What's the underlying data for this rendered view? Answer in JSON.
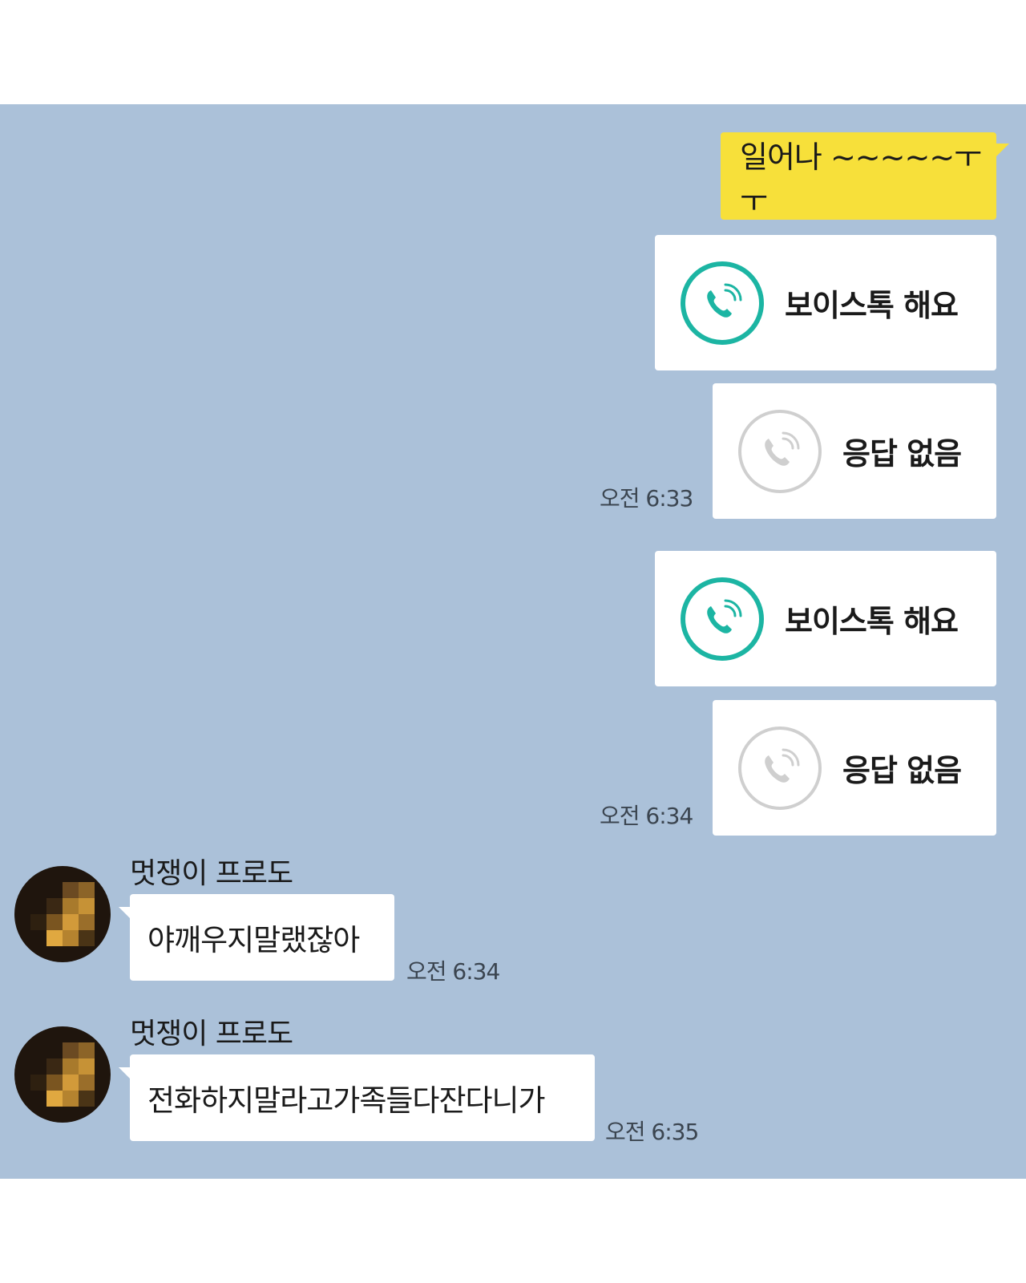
{
  "messages": [
    {
      "type": "text",
      "text": "일어나 ~~~~~ㅜㅜ"
    },
    {
      "type": "call",
      "label": "보이스톡 해요"
    },
    {
      "type": "call",
      "label": "응답 없음",
      "time": "오전 6:33"
    },
    {
      "type": "call",
      "label": "보이스톡 해요"
    },
    {
      "type": "call",
      "label": "응답 없음",
      "time": "오전 6:34"
    },
    {
      "type": "text",
      "sender": "멋쟁이 프로도",
      "text": "야깨우지말랬잖아",
      "time": "오전 6:34"
    },
    {
      "type": "text",
      "sender": "멋쟁이 프로도",
      "text": "전화하지말라고가족들다잔다니가",
      "time": "오전 6:35"
    }
  ],
  "colors": {
    "chat_background": "#abc1d9",
    "my_bubble": "#f7e03a",
    "other_bubble": "#ffffff",
    "call_active": "#1cb5a3",
    "call_missed": "#cfcfcf"
  },
  "icons": {
    "voice_call": "voice-call-icon",
    "missed_call": "missed-call-icon"
  }
}
